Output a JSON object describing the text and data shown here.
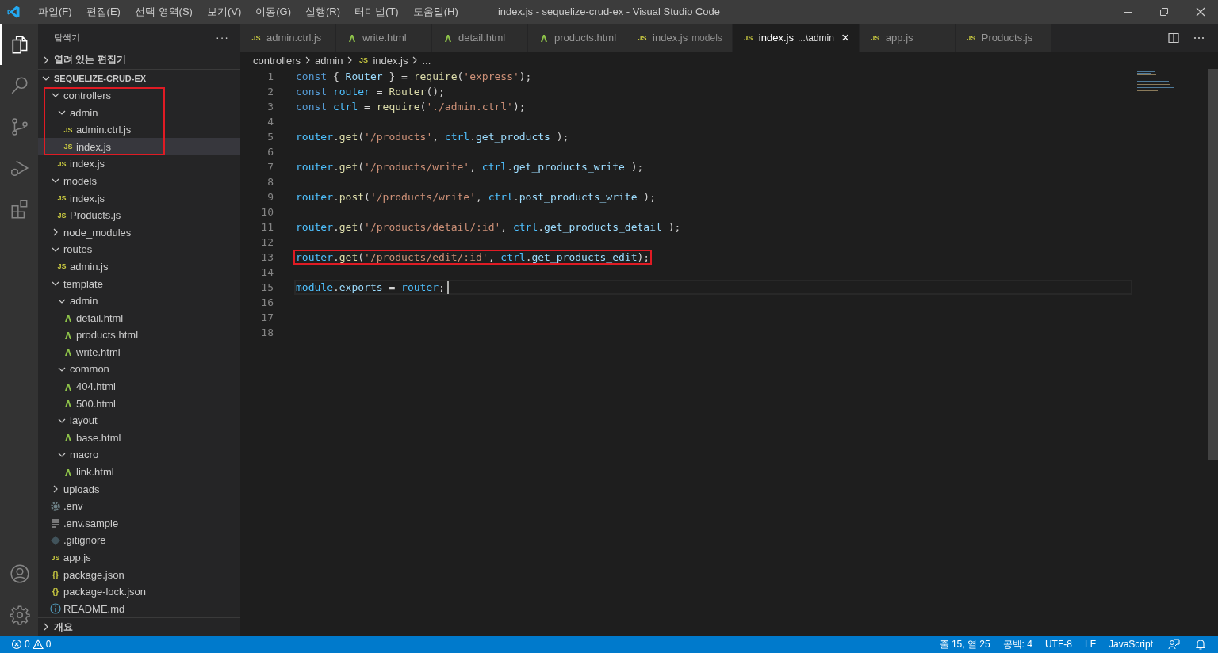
{
  "window": {
    "title": "index.js - sequelize-crud-ex - Visual Studio Code"
  },
  "menu": [
    "파일(F)",
    "편집(E)",
    "선택 영역(S)",
    "보기(V)",
    "이동(G)",
    "실행(R)",
    "터미널(T)",
    "도움말(H)"
  ],
  "activity_bar": [
    {
      "kind": "explorer",
      "selected": true
    },
    {
      "kind": "search",
      "selected": false
    },
    {
      "kind": "scm",
      "selected": false
    },
    {
      "kind": "debug",
      "selected": false
    },
    {
      "kind": "extensions",
      "selected": false
    }
  ],
  "activity_bar_bottom": [
    {
      "kind": "account"
    },
    {
      "kind": "settings"
    }
  ],
  "sidebar": {
    "title": "탐색기",
    "more": "···",
    "open_editors": {
      "label": "열려 있는 편집기",
      "expanded": false
    },
    "project": {
      "label": "SEQUELIZE-CRUD-EX",
      "expanded": true
    },
    "tree": [
      {
        "name": "controllers",
        "kind": "folder",
        "expanded": true,
        "selected": false,
        "outlined": true,
        "children": [
          {
            "name": "admin",
            "kind": "folder",
            "expanded": true,
            "selected": false,
            "outlined": true,
            "children": [
              {
                "name": "admin.ctrl.js",
                "kind": "js",
                "icon": "JS",
                "selected": false,
                "outlined": true
              },
              {
                "name": "index.js",
                "kind": "js",
                "icon": "JS",
                "selected": true,
                "outlined": true
              }
            ]
          },
          {
            "name": "index.js",
            "kind": "js",
            "icon": "JS",
            "selected": false,
            "outlined": false
          }
        ]
      },
      {
        "name": "models",
        "kind": "folder",
        "expanded": true,
        "selected": false,
        "outlined": false,
        "children": [
          {
            "name": "index.js",
            "kind": "js",
            "icon": "JS",
            "selected": false,
            "outlined": false
          },
          {
            "name": "Products.js",
            "kind": "js",
            "icon": "JS",
            "selected": false,
            "outlined": false
          }
        ]
      },
      {
        "name": "node_modules",
        "kind": "folder",
        "expanded": false,
        "selected": false,
        "outlined": false
      },
      {
        "name": "routes",
        "kind": "folder",
        "expanded": true,
        "selected": false,
        "outlined": false,
        "children": [
          {
            "name": "admin.js",
            "kind": "js",
            "icon": "JS",
            "selected": false,
            "outlined": false
          }
        ]
      },
      {
        "name": "template",
        "kind": "folder",
        "expanded": true,
        "selected": false,
        "outlined": false,
        "children": [
          {
            "name": "admin",
            "kind": "folder",
            "expanded": true,
            "selected": false,
            "outlined": false,
            "children": [
              {
                "name": "detail.html",
                "kind": "html",
                "selected": false,
                "outlined": false
              },
              {
                "name": "products.html",
                "kind": "html",
                "selected": false,
                "outlined": false
              },
              {
                "name": "write.html",
                "kind": "html",
                "selected": false,
                "outlined": false
              }
            ]
          },
          {
            "name": "common",
            "kind": "folder",
            "expanded": true,
            "selected": false,
            "outlined": false,
            "children": [
              {
                "name": "404.html",
                "kind": "html",
                "selected": false,
                "outlined": false
              },
              {
                "name": "500.html",
                "kind": "html",
                "selected": false,
                "outlined": false
              }
            ]
          },
          {
            "name": "layout",
            "kind": "folder",
            "expanded": true,
            "selected": false,
            "outlined": false,
            "children": [
              {
                "name": "base.html",
                "kind": "html",
                "selected": false,
                "outlined": false
              }
            ]
          },
          {
            "name": "macro",
            "kind": "folder",
            "expanded": true,
            "selected": false,
            "outlined": false,
            "children": [
              {
                "name": "link.html",
                "kind": "html",
                "selected": false,
                "outlined": false
              }
            ]
          }
        ]
      },
      {
        "name": "uploads",
        "kind": "folder",
        "expanded": false,
        "selected": false,
        "outlined": false
      },
      {
        "name": ".env",
        "kind": "config",
        "selected": false,
        "outlined": false
      },
      {
        "name": ".env.sample",
        "kind": "text",
        "selected": false,
        "outlined": false
      },
      {
        "name": ".gitignore",
        "kind": "git",
        "selected": false,
        "outlined": false
      },
      {
        "name": "app.js",
        "kind": "js",
        "icon": "JS",
        "selected": false,
        "outlined": false
      },
      {
        "name": "package.json",
        "kind": "json",
        "icon": "{}",
        "selected": false,
        "outlined": false
      },
      {
        "name": "package-lock.json",
        "kind": "json",
        "icon": "{}",
        "selected": false,
        "outlined": false
      },
      {
        "name": "README.md",
        "kind": "info",
        "selected": false,
        "outlined": false
      }
    ],
    "outline": {
      "label": "개요",
      "expanded": false
    }
  },
  "tabs": [
    {
      "label": "admin.ctrl.js",
      "kind": "js",
      "icon": "JS",
      "selected": false
    },
    {
      "label": "write.html",
      "kind": "html",
      "selected": false
    },
    {
      "label": "detail.html",
      "kind": "html",
      "selected": false
    },
    {
      "label": "products.html",
      "kind": "html",
      "selected": false
    },
    {
      "label": "index.js",
      "description": "models",
      "kind": "js",
      "icon": "JS",
      "selected": false
    },
    {
      "label": "index.js",
      "description": "...\\admin",
      "kind": "js",
      "icon": "JS",
      "selected": true,
      "close": "×"
    },
    {
      "label": "app.js",
      "kind": "js",
      "icon": "JS",
      "selected": false
    },
    {
      "label": "Products.js",
      "kind": "js",
      "icon": "JS",
      "selected": false
    }
  ],
  "breadcrumb": [
    {
      "label": "controllers"
    },
    {
      "label": "admin"
    },
    {
      "label": "index.js",
      "icon": "JS"
    },
    {
      "label": "..."
    }
  ],
  "code": [
    {
      "number": "1",
      "highlighted": false,
      "current": false,
      "tokens": [
        {
          "kind": "keyword",
          "text": "const"
        },
        {
          "kind": "plain",
          "text": "{ "
        },
        {
          "kind": "variable",
          "text": "Router"
        },
        {
          "kind": "plain",
          "text": " } = "
        },
        {
          "kind": "function",
          "text": "require"
        },
        {
          "kind": "plain",
          "text": "("
        },
        {
          "kind": "string",
          "text": "'express'"
        },
        {
          "kind": "plain",
          "text": ");"
        }
      ]
    },
    {
      "number": "2",
      "highlighted": false,
      "current": false,
      "tokens": [
        {
          "kind": "keyword",
          "text": "const"
        },
        {
          "kind": "constant",
          "text": "router"
        },
        {
          "kind": "plain",
          "text": " = "
        },
        {
          "kind": "function",
          "text": "Router"
        },
        {
          "kind": "plain",
          "text": "();"
        }
      ]
    },
    {
      "number": "3",
      "highlighted": false,
      "current": false,
      "tokens": [
        {
          "kind": "keyword",
          "text": "const"
        },
        {
          "kind": "constant",
          "text": "ctrl"
        },
        {
          "kind": "plain",
          "text": " = "
        },
        {
          "kind": "function",
          "text": "require"
        },
        {
          "kind": "plain",
          "text": "("
        },
        {
          "kind": "string",
          "text": "'./admin.ctrl'"
        },
        {
          "kind": "plain",
          "text": ");"
        }
      ]
    },
    {
      "number": "4",
      "highlighted": false,
      "current": false
    },
    {
      "number": "5",
      "highlighted": false,
      "current": false,
      "tokens": [
        {
          "kind": "constant",
          "text": "router"
        },
        {
          "kind": "plain",
          "text": "."
        },
        {
          "kind": "function",
          "text": "get"
        },
        {
          "kind": "plain",
          "text": "("
        },
        {
          "kind": "string",
          "text": "'/products'"
        },
        {
          "kind": "plain",
          "text": ", "
        },
        {
          "kind": "constant",
          "text": "ctrl"
        },
        {
          "kind": "plain",
          "text": "."
        },
        {
          "kind": "property",
          "text": "get_products"
        },
        {
          "kind": "plain",
          "text": " );"
        }
      ]
    },
    {
      "number": "6",
      "highlighted": false,
      "current": false
    },
    {
      "number": "7",
      "highlighted": false,
      "current": false,
      "tokens": [
        {
          "kind": "constant",
          "text": "router"
        },
        {
          "kind": "plain",
          "text": "."
        },
        {
          "kind": "function",
          "text": "get"
        },
        {
          "kind": "plain",
          "text": "("
        },
        {
          "kind": "string",
          "text": "'/products/write'"
        },
        {
          "kind": "plain",
          "text": ", "
        },
        {
          "kind": "constant",
          "text": "ctrl"
        },
        {
          "kind": "plain",
          "text": "."
        },
        {
          "kind": "property",
          "text": "get_products_write"
        },
        {
          "kind": "plain",
          "text": " );"
        }
      ]
    },
    {
      "number": "8",
      "highlighted": false,
      "current": false
    },
    {
      "number": "9",
      "highlighted": false,
      "current": false,
      "tokens": [
        {
          "kind": "constant",
          "text": "router"
        },
        {
          "kind": "plain",
          "text": "."
        },
        {
          "kind": "function",
          "text": "post"
        },
        {
          "kind": "plain",
          "text": "("
        },
        {
          "kind": "string",
          "text": "'/products/write'"
        },
        {
          "kind": "plain",
          "text": ", "
        },
        {
          "kind": "constant",
          "text": "ctrl"
        },
        {
          "kind": "plain",
          "text": "."
        },
        {
          "kind": "property",
          "text": "post_products_write"
        },
        {
          "kind": "plain",
          "text": " );"
        }
      ]
    },
    {
      "number": "10",
      "highlighted": false,
      "current": false
    },
    {
      "number": "11",
      "highlighted": false,
      "current": false,
      "tokens": [
        {
          "kind": "constant",
          "text": "router"
        },
        {
          "kind": "plain",
          "text": "."
        },
        {
          "kind": "function",
          "text": "get"
        },
        {
          "kind": "plain",
          "text": "("
        },
        {
          "kind": "string",
          "text": "'/products/detail/:id'"
        },
        {
          "kind": "plain",
          "text": ", "
        },
        {
          "kind": "constant",
          "text": "ctrl"
        },
        {
          "kind": "plain",
          "text": "."
        },
        {
          "kind": "property",
          "text": "get_products_detail"
        },
        {
          "kind": "plain",
          "text": " );"
        }
      ]
    },
    {
      "number": "12",
      "highlighted": false,
      "current": false
    },
    {
      "number": "13",
      "highlighted": true,
      "current": false,
      "tokens": [
        {
          "kind": "constant",
          "text": "router"
        },
        {
          "kind": "plain",
          "text": "."
        },
        {
          "kind": "function",
          "text": "get"
        },
        {
          "kind": "plain",
          "text": "("
        },
        {
          "kind": "string",
          "text": "'/products/edit/:id'"
        },
        {
          "kind": "plain",
          "text": ", "
        },
        {
          "kind": "constant",
          "text": "ctrl"
        },
        {
          "kind": "plain",
          "text": "."
        },
        {
          "kind": "property",
          "text": "get_products_edit"
        },
        {
          "kind": "plain",
          "text": ");"
        }
      ]
    },
    {
      "number": "14",
      "highlighted": false,
      "current": false
    },
    {
      "number": "15",
      "highlighted": false,
      "current": true,
      "tokens": [
        {
          "kind": "constant",
          "text": "module"
        },
        {
          "kind": "plain",
          "text": "."
        },
        {
          "kind": "property",
          "text": "exports"
        },
        {
          "kind": "plain",
          "text": " = "
        },
        {
          "kind": "constant",
          "text": "router"
        },
        {
          "kind": "plain",
          "text": ";"
        }
      ]
    },
    {
      "number": "16",
      "highlighted": false,
      "current": false
    },
    {
      "number": "17",
      "highlighted": false,
      "current": false
    },
    {
      "number": "18",
      "highlighted": false,
      "current": false
    }
  ],
  "status_bar": {
    "errors": "0",
    "warnings": "0",
    "items": [
      "줄 15, 열 25",
      "공백: 4",
      "UTF-8",
      "LF",
      "JavaScript"
    ]
  }
}
